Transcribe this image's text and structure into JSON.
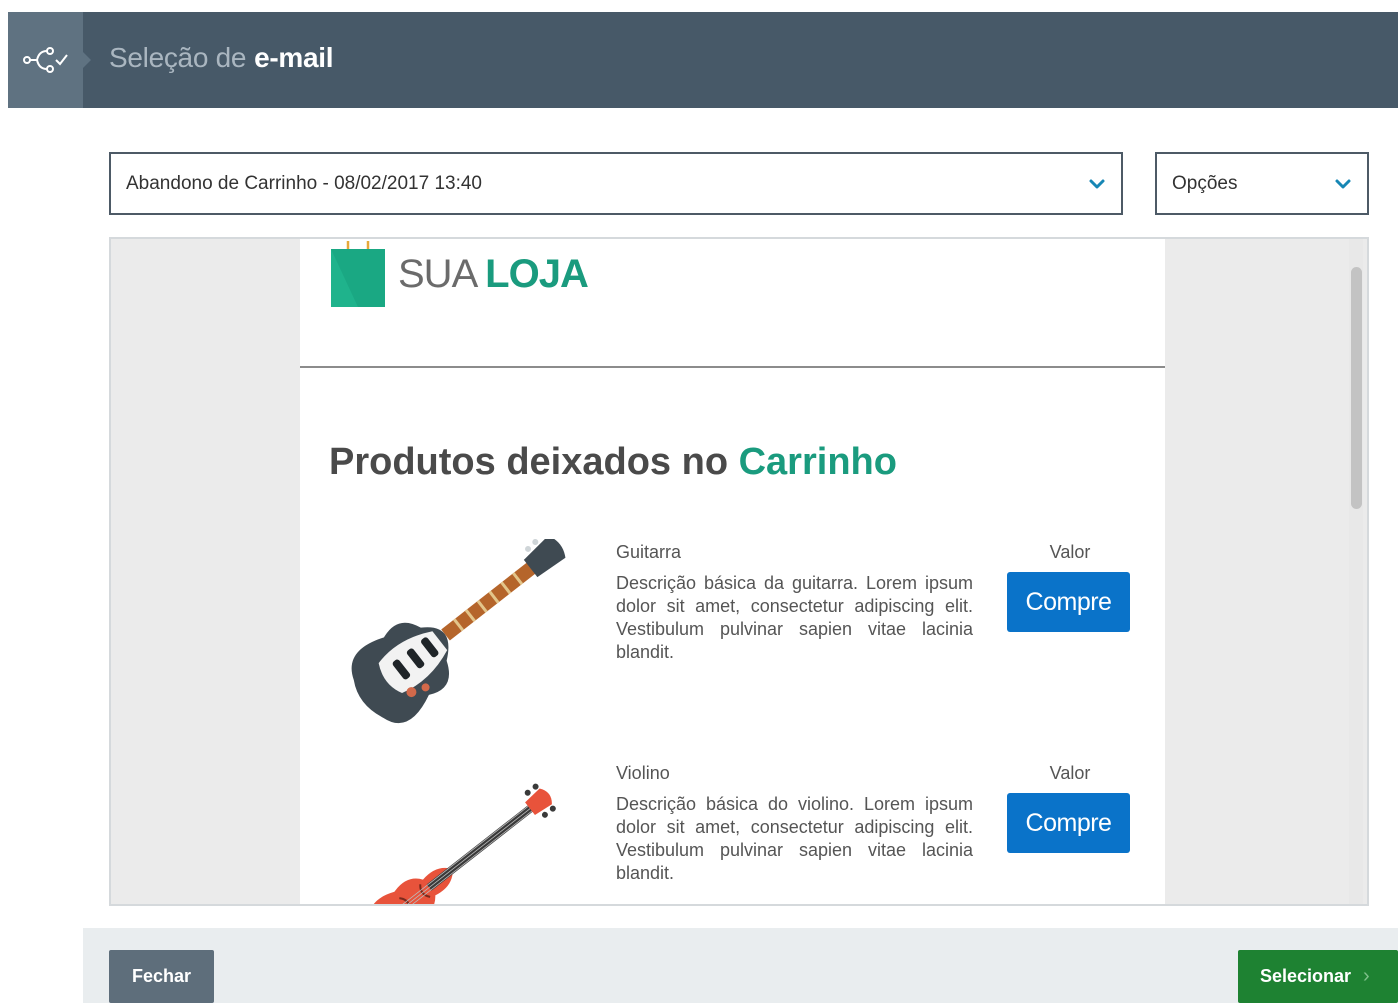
{
  "header": {
    "icon": "workflow-check-icon",
    "title_prefix": "Seleção de",
    "title_bold": "e-mail"
  },
  "email_select": {
    "value": "Abandono de Carrinho - 08/02/2017 13:40",
    "icon": "chevron-down-icon"
  },
  "options_select": {
    "value": "Opções",
    "icon": "chevron-down-icon"
  },
  "preview": {
    "logo_light": "SUA",
    "logo_bold": "LOJA",
    "headline_prefix": "Produtos deixados no",
    "headline_accent": "Carrinho",
    "products": [
      {
        "name": "Guitarra",
        "description": "Descrição básica da guitarra. Lorem ipsum dolor sit amet, consectetur adipiscing elit. Vestibulum pulvinar sapien vitae lacinia blandit.",
        "value_label": "Valor",
        "button_label": "Compre",
        "icon": "guitar-icon"
      },
      {
        "name": "Violino",
        "description": "Descrição básica do violino. Lorem ipsum dolor sit amet, consectetur adipiscing elit. Vestibulum pulvinar sapien vitae lacinia blandit.",
        "value_label": "Valor",
        "button_label": "Compre",
        "icon": "violin-icon"
      }
    ]
  },
  "footer": {
    "close_label": "Fechar",
    "select_label": "Selecionar",
    "select_icon": "chevron-right-icon"
  },
  "colors": {
    "header_bg": "#475968",
    "accent_green": "#1a9b7e",
    "buy_blue": "#0a73c9",
    "select_green": "#1e8232"
  }
}
